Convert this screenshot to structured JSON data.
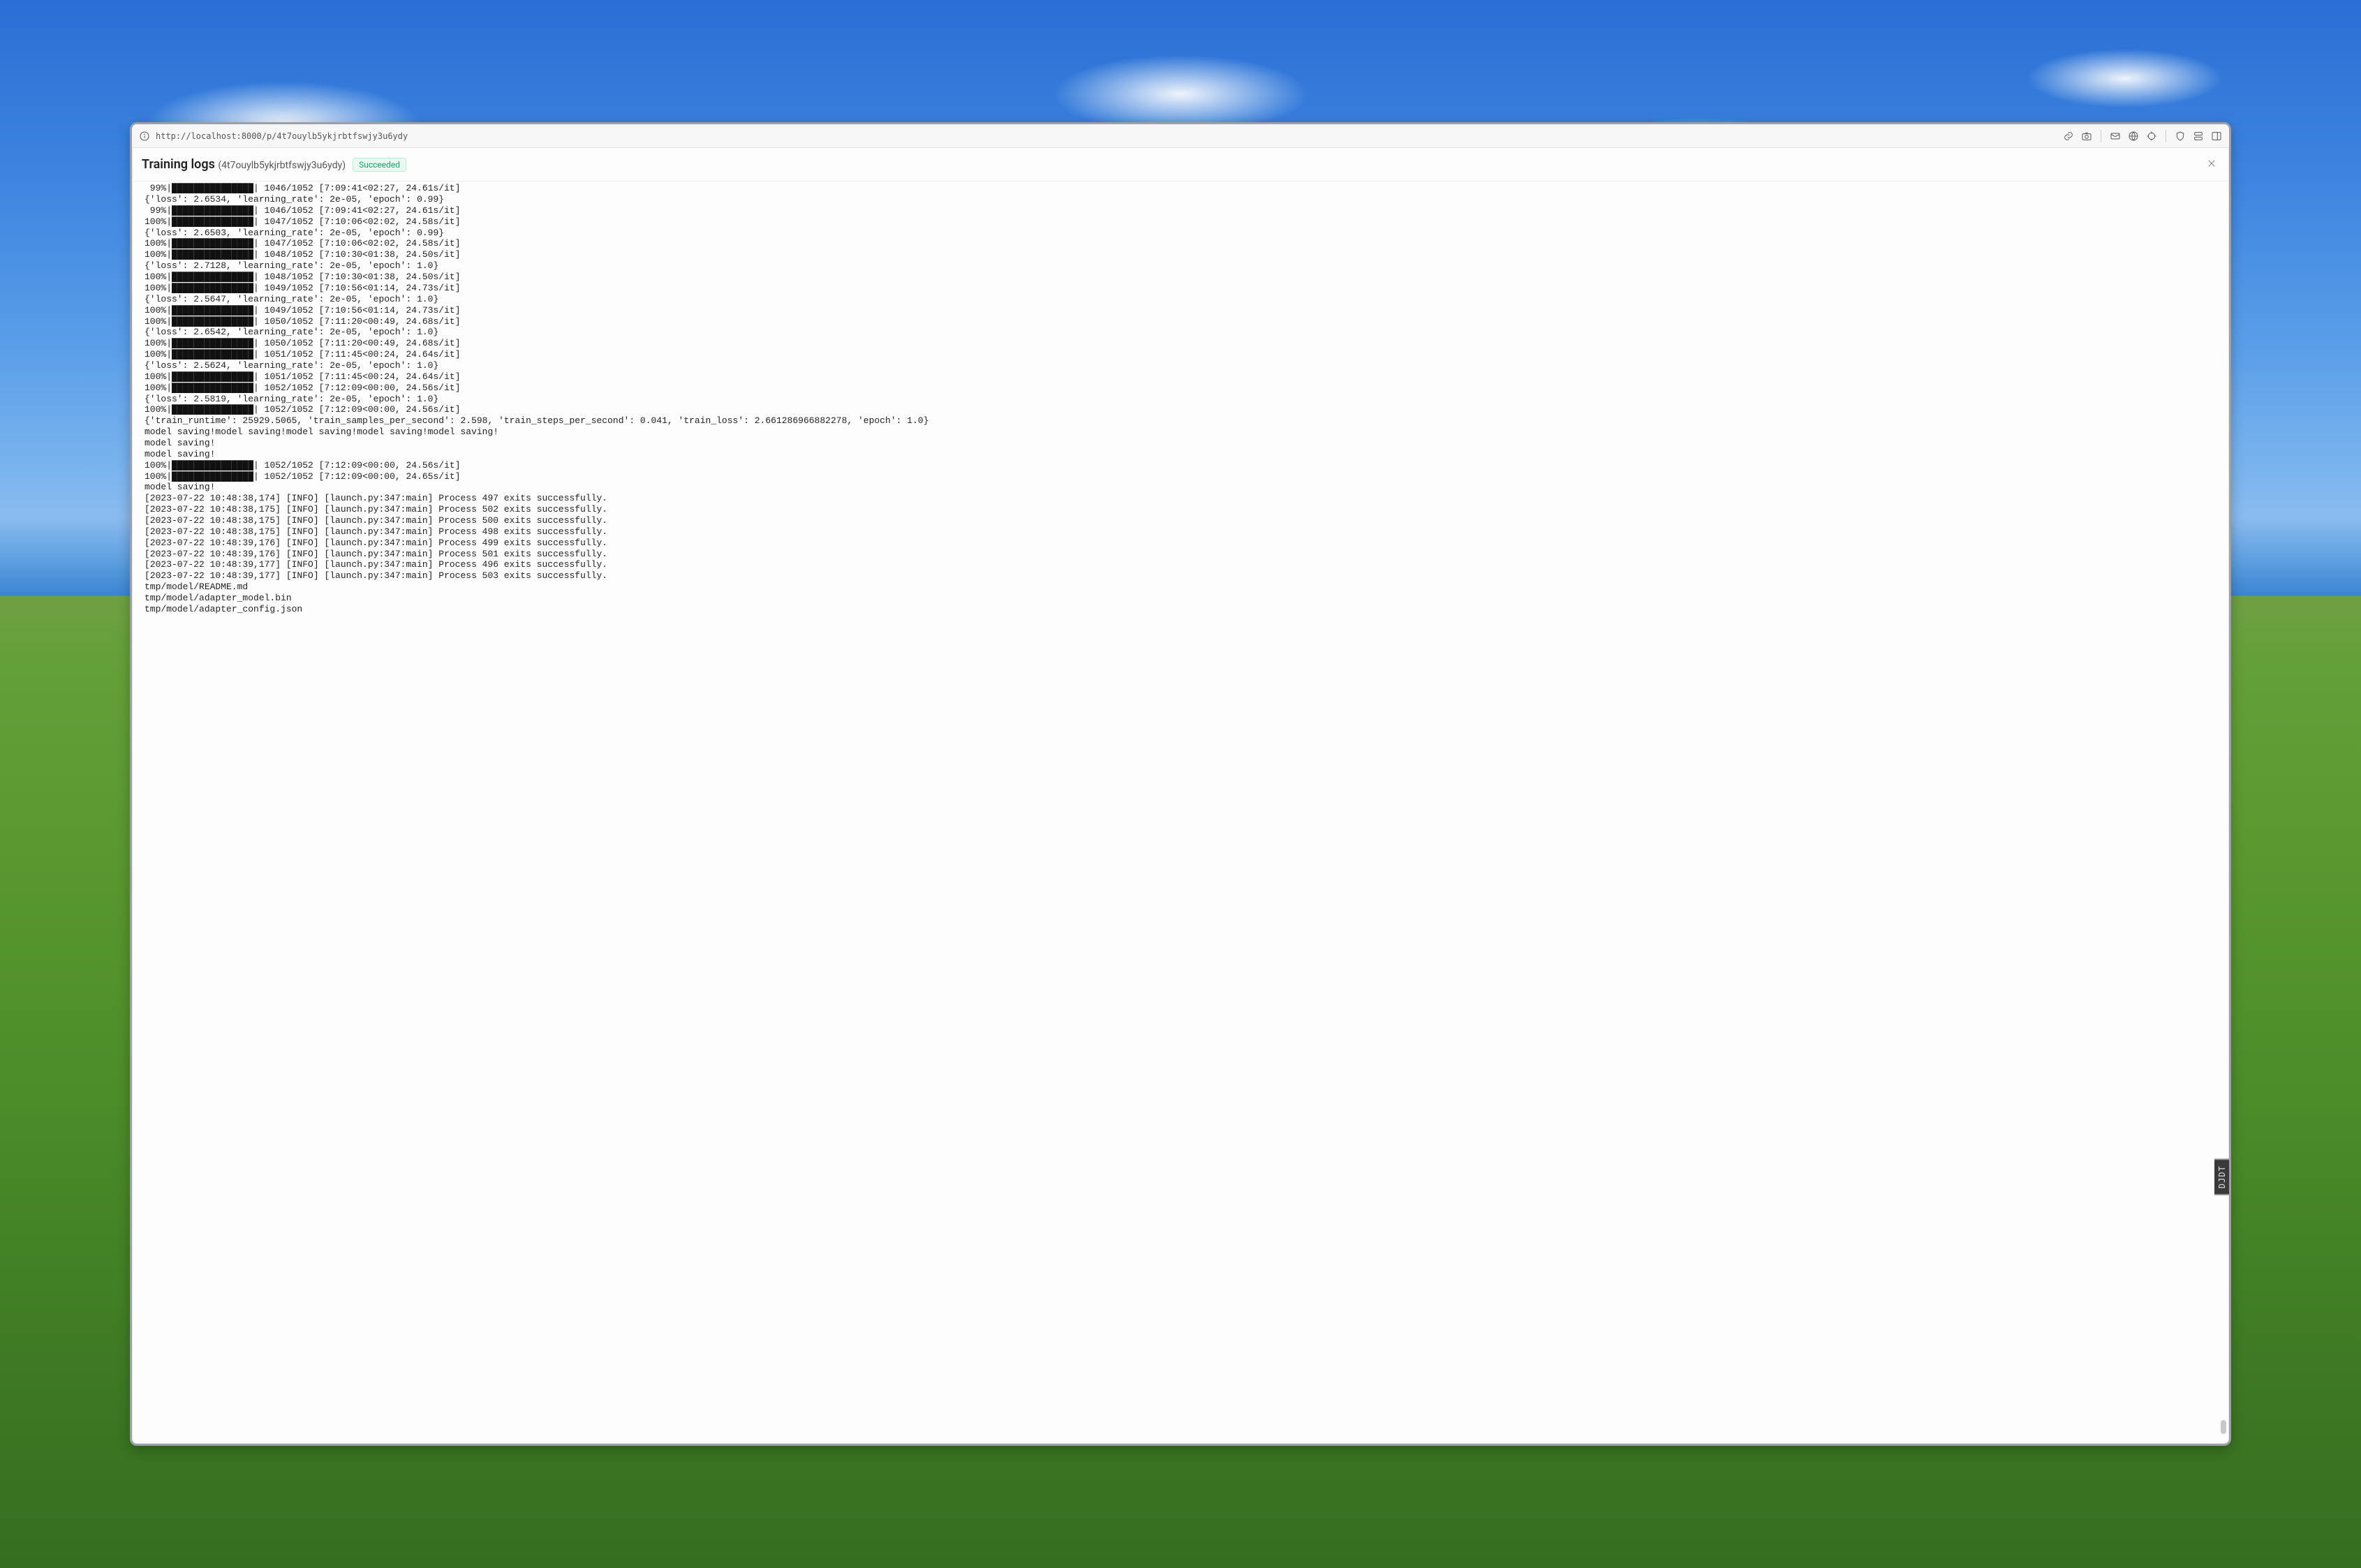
{
  "address_bar": {
    "url": "http://localhost:8000/p/4t7ouylb5ykjrbtfswjy3u6ydy"
  },
  "header": {
    "title": "Training logs",
    "subtitle": "(4t7ouylb5ykjrbtfswjy3u6ydy)",
    "status_label": "Succeeded"
  },
  "djdt_label": "DJDT",
  "log_lines": [
    " 99%|███████████████| 1046/1052 [7:09:41<02:27, 24.61s/it]",
    "{'loss': 2.6534, 'learning_rate': 2e-05, 'epoch': 0.99}",
    " 99%|███████████████| 1046/1052 [7:09:41<02:27, 24.61s/it]",
    "100%|███████████████| 1047/1052 [7:10:06<02:02, 24.58s/it]",
    "{'loss': 2.6503, 'learning_rate': 2e-05, 'epoch': 0.99}",
    "100%|███████████████| 1047/1052 [7:10:06<02:02, 24.58s/it]",
    "100%|███████████████| 1048/1052 [7:10:30<01:38, 24.50s/it]",
    "{'loss': 2.7128, 'learning_rate': 2e-05, 'epoch': 1.0}",
    "100%|███████████████| 1048/1052 [7:10:30<01:38, 24.50s/it]",
    "100%|███████████████| 1049/1052 [7:10:56<01:14, 24.73s/it]",
    "{'loss': 2.5647, 'learning_rate': 2e-05, 'epoch': 1.0}",
    "100%|███████████████| 1049/1052 [7:10:56<01:14, 24.73s/it]",
    "100%|███████████████| 1050/1052 [7:11:20<00:49, 24.68s/it]",
    "{'loss': 2.6542, 'learning_rate': 2e-05, 'epoch': 1.0}",
    "100%|███████████████| 1050/1052 [7:11:20<00:49, 24.68s/it]",
    "100%|███████████████| 1051/1052 [7:11:45<00:24, 24.64s/it]",
    "{'loss': 2.5624, 'learning_rate': 2e-05, 'epoch': 1.0}",
    "100%|███████████████| 1051/1052 [7:11:45<00:24, 24.64s/it]",
    "100%|███████████████| 1052/1052 [7:12:09<00:00, 24.56s/it]",
    "{'loss': 2.5819, 'learning_rate': 2e-05, 'epoch': 1.0}",
    "100%|███████████████| 1052/1052 [7:12:09<00:00, 24.56s/it]",
    "{'train_runtime': 25929.5065, 'train_samples_per_second': 2.598, 'train_steps_per_second': 0.041, 'train_loss': 2.661286966882278, 'epoch': 1.0}",
    "model saving!model saving!model saving!model saving!model saving!",
    "model saving!",
    "model saving!",
    "100%|███████████████| 1052/1052 [7:12:09<00:00, 24.56s/it]",
    "100%|███████████████| 1052/1052 [7:12:09<00:00, 24.65s/it]",
    "model saving!",
    "[2023-07-22 10:48:38,174] [INFO] [launch.py:347:main] Process 497 exits successfully.",
    "[2023-07-22 10:48:38,175] [INFO] [launch.py:347:main] Process 502 exits successfully.",
    "[2023-07-22 10:48:38,175] [INFO] [launch.py:347:main] Process 500 exits successfully.",
    "[2023-07-22 10:48:38,175] [INFO] [launch.py:347:main] Process 498 exits successfully.",
    "[2023-07-22 10:48:39,176] [INFO] [launch.py:347:main] Process 499 exits successfully.",
    "[2023-07-22 10:48:39,176] [INFO] [launch.py:347:main] Process 501 exits successfully.",
    "[2023-07-22 10:48:39,177] [INFO] [launch.py:347:main] Process 496 exits successfully.",
    "[2023-07-22 10:48:39,177] [INFO] [launch.py:347:main] Process 503 exits successfully.",
    "tmp/model/README.md",
    "tmp/model/adapter_model.bin",
    "tmp/model/adapter_config.json"
  ]
}
